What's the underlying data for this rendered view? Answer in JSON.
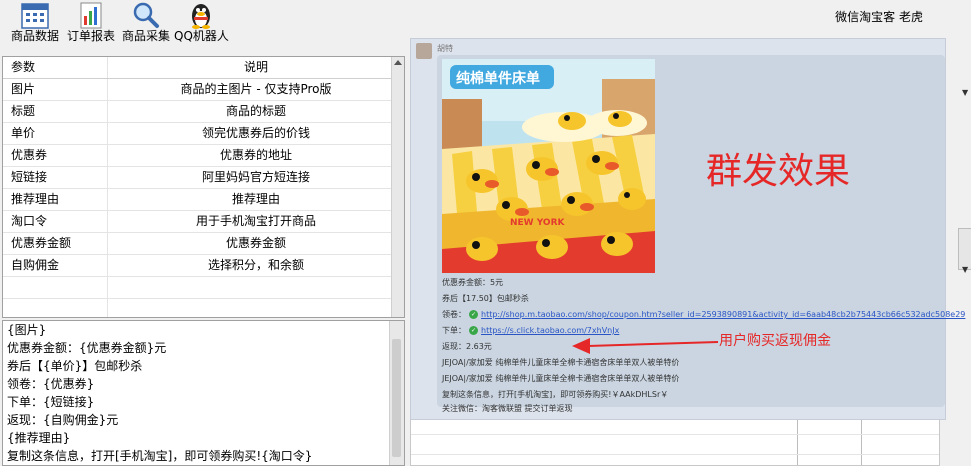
{
  "toolbar": {
    "items": [
      {
        "label": "商品数据",
        "icon": "calendar-icon"
      },
      {
        "label": "订单报表",
        "icon": "bar-report-icon"
      },
      {
        "label": "商品采集",
        "icon": "magnifier-icon"
      },
      {
        "label": "QQ机器人",
        "icon": "qq-penguin-icon"
      }
    ],
    "brand": "微信淘宝客  老虎"
  },
  "param_table": {
    "headers": [
      "参数",
      "说明"
    ],
    "rows": [
      [
        "图片",
        "商品的主图片 - 仅支持Pro版"
      ],
      [
        "标题",
        "商品的标题"
      ],
      [
        "单价",
        "领完优惠券后的价钱"
      ],
      [
        "优惠券",
        "优惠券的地址"
      ],
      [
        "短链接",
        "阿里妈妈官方短连接"
      ],
      [
        "推荐理由",
        "推荐理由"
      ],
      [
        "淘口令",
        "用于手机淘宝打开商品"
      ],
      [
        "优惠券金额",
        "优惠券金额"
      ],
      [
        "自购佣金",
        "选择积分，和余额"
      ]
    ]
  },
  "template_lines": [
    "{图片}",
    "优惠券金额：{优惠券金额}元",
    "券后【{单价}】包邮秒杀",
    "领卷：{优惠券}",
    "下单：{短链接}",
    "返现：{自购佣金}元",
    "{推荐理由}",
    "复制这条信息，打开[手机淘宝]，即可领券购买!{淘口令}"
  ],
  "chat": {
    "nickname": "胡特",
    "product_banner": "纯棉单件床单",
    "product_sign": "NEW YORK",
    "coupon_amount": "优惠券金额：5元",
    "after_coupon": "券后【17.50】包邮秒杀",
    "coupon_label": "领卷：",
    "coupon_url": "http://shop.m.taobao.com/shop/coupon.htm?seller_id=2593890891&activity_id=6aab48cb2b75443cb66c532adc508e29",
    "order_label": "下单：",
    "order_url": "https://s.click.taobao.com/7xhVnJx",
    "cashback": "返现：2.63元",
    "reason1": "JEJOA|/家加爱 纯棉单件儿童床单全棉卡通宿舍床单单双人被单特价",
    "reason2": "JEJOA|/家加爱 纯棉单件儿童床单全棉卡通宿舍床单单双人被单特价",
    "copy_text": "复制这条信息，打开[手机淘宝]，即可领券购买!￥AAkDHLSr￥",
    "follow_text": "关注微信：淘客微联盟  提交订单返现"
  },
  "annotations": {
    "effect": "群发效果",
    "cashback_note": "用户购买返现佣金"
  },
  "colors": {
    "accent_red": "#e62727",
    "link_blue": "#2a55c5",
    "chat_bg": "#cad5e1"
  }
}
